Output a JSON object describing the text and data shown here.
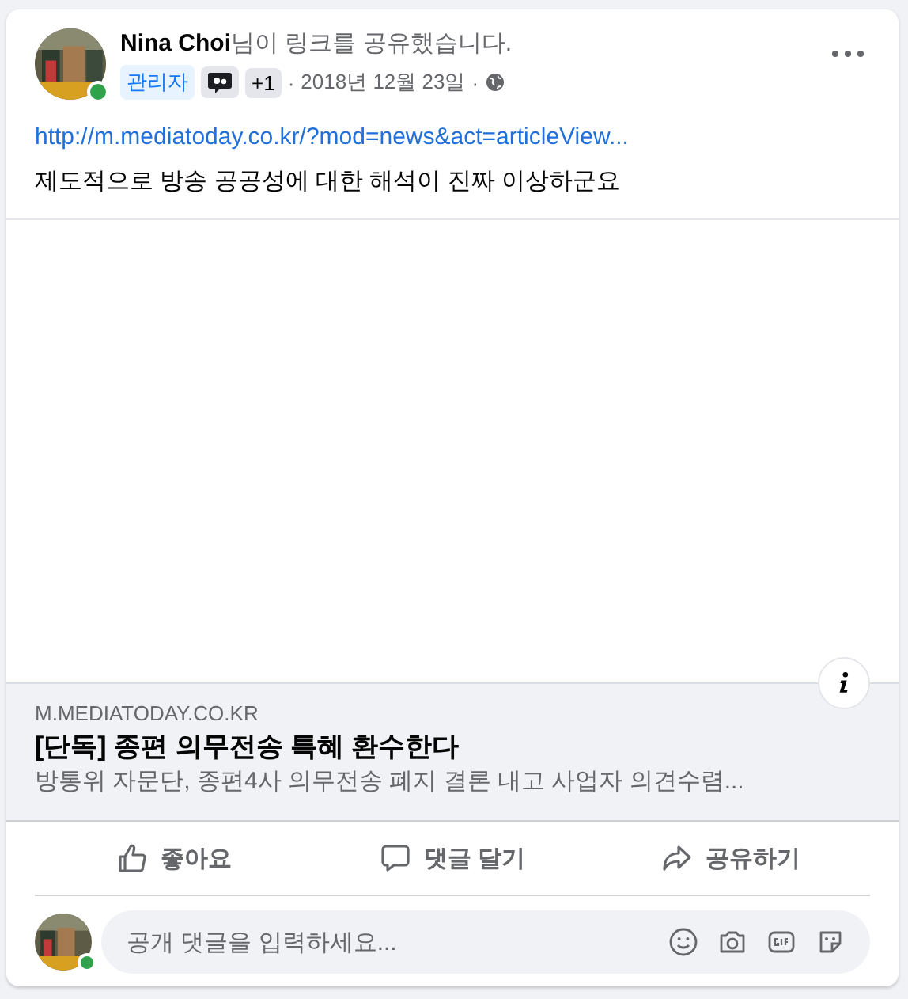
{
  "post": {
    "author": "Nina Choi",
    "action": "님이 링크를 공유했습니다.",
    "badges": [
      {
        "kind": "role",
        "label": "관리자"
      },
      {
        "kind": "icon"
      },
      {
        "kind": "count",
        "label": "+1"
      }
    ],
    "date": "2018년 12월 23일",
    "separator": "·",
    "url": "http://m.mediatoday.co.kr/?mod=news&act=articleView...",
    "text": "제도적으로 방송 공공성에 대한 해석이 진짜 이상하군요"
  },
  "preview": {
    "domain": "M.MEDIATODAY.CO.KR",
    "title": "[단독] 종편 의무전송 특혜 환수한다",
    "description": "방통위 자문단, 종편4사 의무전송 폐지 결론 내고 사업자 의견수렴..."
  },
  "actions": [
    {
      "kind": "like",
      "label": "좋아요"
    },
    {
      "kind": "comment",
      "label": "댓글 달기"
    },
    {
      "kind": "share",
      "label": "공유하기"
    }
  ],
  "comment_box": {
    "placeholder": "공개 댓글을 입력하세요..."
  }
}
